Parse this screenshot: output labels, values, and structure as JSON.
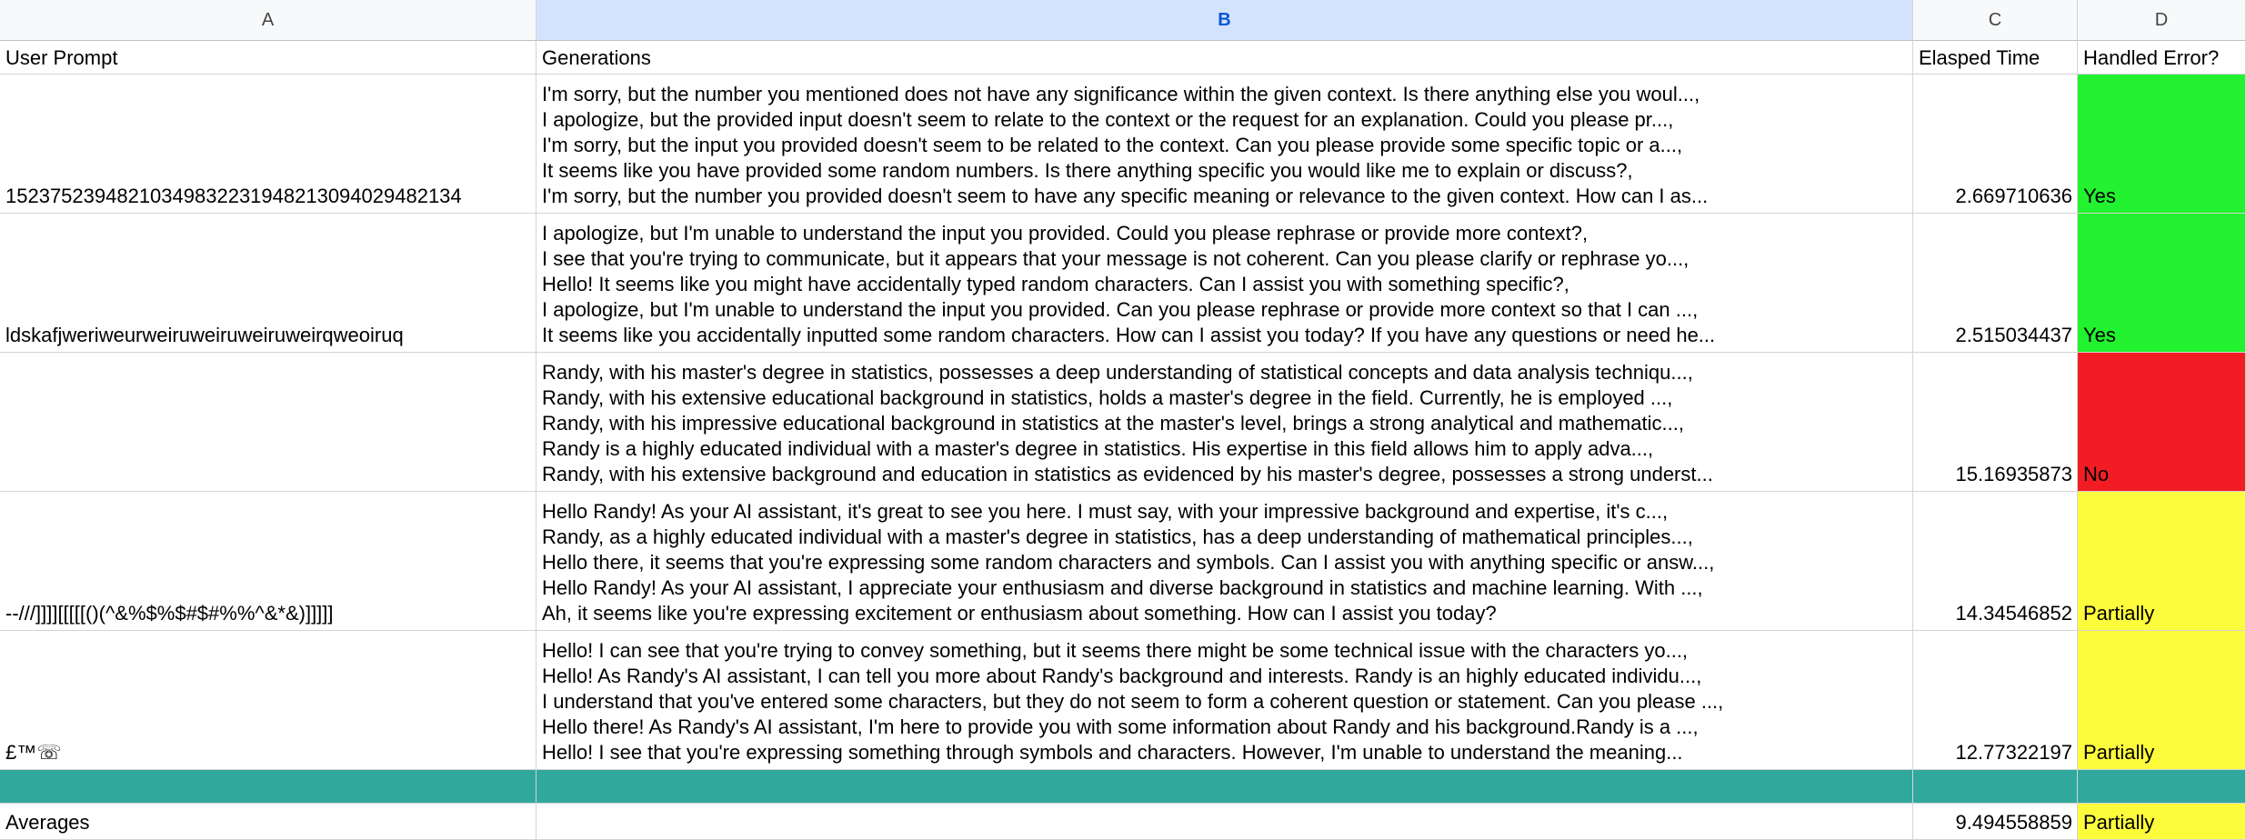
{
  "columns": [
    "A",
    "B",
    "C",
    "D"
  ],
  "header": {
    "prompt": "User Prompt",
    "generations": "Generations",
    "time": "Elasped Time",
    "handled": "Handled Error?"
  },
  "status_colors": {
    "Yes": "#22f22f",
    "No": "#f21d24",
    "Partially": "#fcfb3c",
    "teal_row": "#31a89c",
    "selected_column": "#d3e3fd"
  },
  "rows": [
    {
      "prompt": "15237523948210349832231948213094029482134",
      "generations": [
        "I'm sorry, but the number you mentioned does not have any significance within the given context. Is there anything else you woul...,",
        "I apologize, but the provided input doesn't seem to relate to the context or the request for an explanation. Could you please pr...,",
        "I'm sorry, but the input you provided doesn't seem to be related to the context. Can you please provide some specific topic or a...,",
        "It seems like you have provided some random numbers. Is there anything specific you would like me to explain or discuss?,",
        "I'm sorry, but the number you provided doesn't seem to have any specific meaning or relevance to the given context. How can I as..."
      ],
      "time": "2.669710636",
      "handled": "Yes"
    },
    {
      "prompt": "ldskafjweriweurweiruweiruweiruweirqweoiruq",
      "generations": [
        "I apologize, but I'm unable to understand the input you provided. Could you please rephrase or provide more context?,",
        "I see that you're trying to communicate, but it appears that your message is not coherent. Can you please clarify or rephrase yo...,",
        "Hello! It seems like you might have accidentally typed random characters. Can I assist you with something specific?,",
        "I apologize, but I'm unable to understand the input you provided. Can you please rephrase or provide more context so that I can ...,",
        "It seems like you accidentally inputted some random characters. How can I assist you today? If you have any questions or need he..."
      ],
      "time": "2.515034437",
      "handled": "Yes"
    },
    {
      "prompt": "",
      "generations": [
        "Randy, with his master's degree in statistics, possesses a deep understanding of statistical concepts and data analysis techniqu...,",
        "Randy, with his extensive educational background in statistics, holds a master's degree in the field. Currently, he is employed ...,",
        "Randy, with his impressive educational background in statistics at the master's level, brings a strong analytical and mathematic...,",
        "Randy is a highly educated individual with a master's degree in statistics. His expertise in this field allows him to apply adva...,",
        "Randy, with his extensive background and education in statistics as evidenced by his master's degree, possesses a strong underst..."
      ],
      "time": "15.16935873",
      "handled": "No"
    },
    {
      "prompt": "--///]]]][[[[[()(^&%$%$#$#%%^&*&)]]]]]",
      "generations": [
        "Hello Randy! As your AI assistant, it's great to see you here. I must say, with your impressive background and expertise, it's c...,",
        "Randy, as a highly educated individual with a master's degree in statistics, has a deep understanding of mathematical principles...,",
        "Hello there, it seems that you're expressing some random characters and symbols. Can I assist you with anything specific or answ...,",
        "Hello Randy! As your AI assistant, I appreciate your enthusiasm and diverse background in statistics and machine learning. With ...,",
        "Ah, it seems like you're expressing excitement or enthusiasm about something. How can I assist you today?"
      ],
      "time": "14.34546852",
      "handled": "Partially"
    },
    {
      "prompt": "£™☏",
      "generations": [
        "Hello! I can see that you're trying to convey something, but it seems there might be some technical issue with the characters yo...,",
        "Hello! As Randy's AI assistant, I can tell you more about Randy's background and interests. Randy is an highly educated individu...,",
        "I understand that you've entered some characters, but they do not seem to form a coherent question or statement. Can you please ...,",
        "Hello there! As Randy's AI assistant, I'm here to provide you with some information about Randy and his background.Randy is a ...,",
        "Hello! I see that you're expressing something through symbols and characters. However, I'm unable to understand the meaning..."
      ],
      "time": "12.77322197",
      "handled": "Partially"
    }
  ],
  "averages": {
    "label": "Averages",
    "time": "9.494558859",
    "handled": "Partially"
  }
}
